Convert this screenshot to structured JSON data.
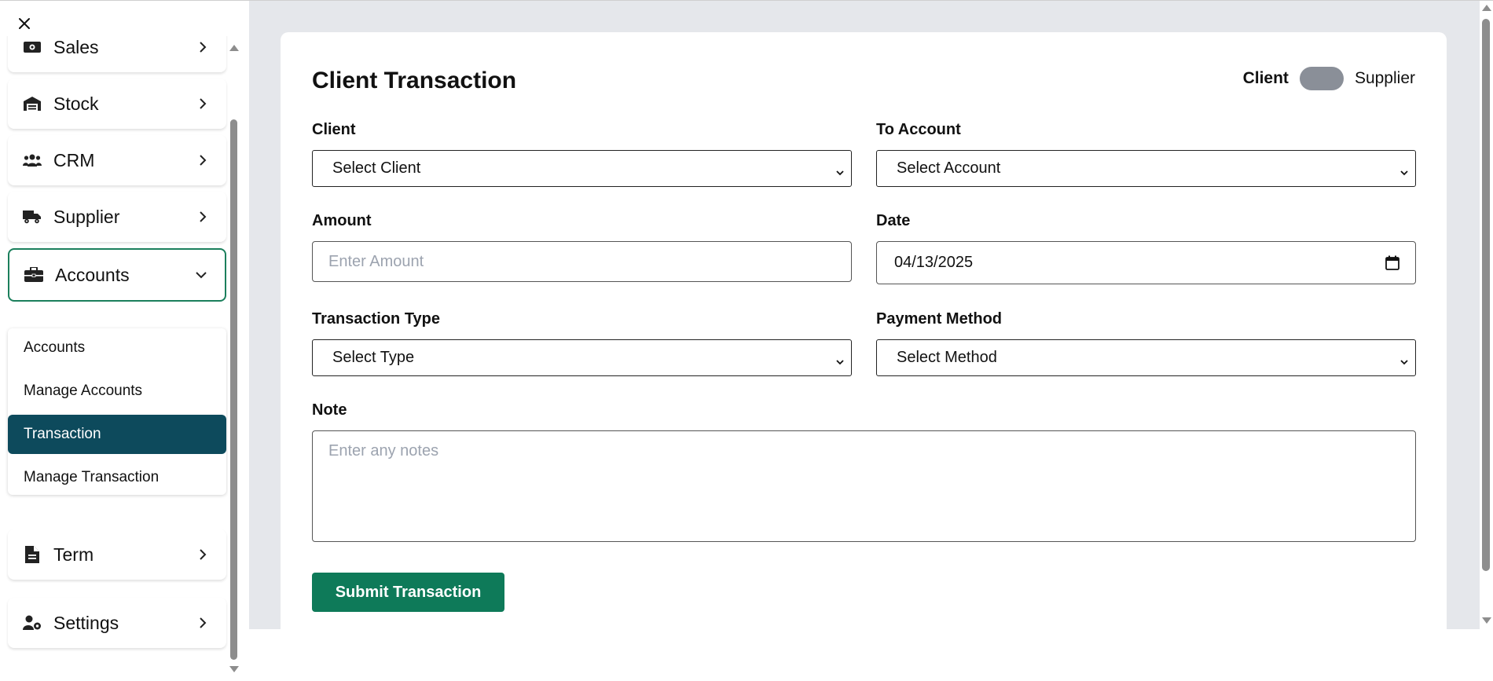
{
  "sidebar": {
    "items": [
      {
        "label": "Sales",
        "icon": "money-bill-icon"
      },
      {
        "label": "Stock",
        "icon": "warehouse-icon"
      },
      {
        "label": "CRM",
        "icon": "users-icon"
      },
      {
        "label": "Supplier",
        "icon": "truck-icon"
      },
      {
        "label": "Accounts",
        "icon": "briefcase-icon",
        "expanded": true
      },
      {
        "label": "Term",
        "icon": "file-icon"
      },
      {
        "label": "Settings",
        "icon": "user-gear-icon"
      }
    ],
    "accounts_submenu": [
      {
        "label": "Accounts"
      },
      {
        "label": "Manage Accounts"
      },
      {
        "label": "Transaction",
        "selected": true
      },
      {
        "label": "Manage Transaction"
      }
    ]
  },
  "form": {
    "title": "Client Transaction",
    "toggle": {
      "left_label": "Client",
      "right_label": "Supplier"
    },
    "client": {
      "label": "Client",
      "value": "Select Client"
    },
    "to_account": {
      "label": "To Account",
      "value": "Select Account"
    },
    "amount": {
      "label": "Amount",
      "placeholder": "Enter Amount"
    },
    "date": {
      "label": "Date",
      "value": "04/13/2025"
    },
    "transaction_type": {
      "label": "Transaction Type",
      "value": "Select Type"
    },
    "payment_method": {
      "label": "Payment Method",
      "value": "Select Method"
    },
    "note": {
      "label": "Note",
      "placeholder": "Enter any notes"
    },
    "submit_label": "Submit Transaction"
  },
  "colors": {
    "accent": "#0e7a59",
    "active_nav_border": "#1b7f5c",
    "selected_submenu": "#0d4a5c",
    "main_bg": "#e5e7eb",
    "toggle": "#8a8f98"
  }
}
